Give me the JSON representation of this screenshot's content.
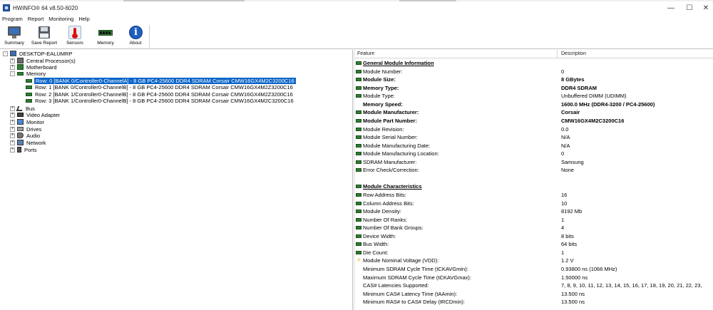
{
  "window": {
    "title": "HWiNFO® 64 v8.50-6020",
    "minimize_glyph": "—",
    "maximize_glyph": "☐",
    "close_glyph": "✕"
  },
  "menu": [
    "Program",
    "Report",
    "Monitoring",
    "Help"
  ],
  "toolbar": [
    {
      "label": "Summary",
      "icon": "monitor-icon"
    },
    {
      "label": "Save Report",
      "icon": "floppy-disk-icon"
    },
    {
      "label": "Sensors",
      "icon": "thermometer-icon"
    },
    {
      "label": "Memory",
      "icon": "ram-stick-icon"
    },
    {
      "label": "About",
      "icon": "info-icon"
    }
  ],
  "tree": {
    "root": "DESKTOP-EALUMRP",
    "nodes": [
      {
        "label": "Central Processor(s)",
        "expander": "+"
      },
      {
        "label": "Motherboard",
        "expander": "+"
      },
      {
        "label": "Memory",
        "expander": "-"
      }
    ],
    "memory_rows": [
      "Row: 0 [BANK 0/Controller0-ChannelA] - 8 GB PC4-25600 DDR4 SDRAM Corsair CMW16GX4M2C3200C16",
      "Row: 1 [BANK 0/Controller0-ChannelB] - 8 GB PC4-25600 DDR4 SDRAM Corsair CMW16GX4M2Z3200C16",
      "Row: 2 [BANK 1/Controller0-ChannelB] - 8 GB PC4-25600 DDR4 SDRAM Corsair CMW16GX4M2Z3200C16",
      "Row: 3 [BANK 1/Controller0-ChannelB] - 8 GB PC4-25600 DDR4 SDRAM Corsair CMW16GX4M2C3200C16"
    ],
    "other_nodes": [
      {
        "label": "Bus",
        "expander": "+"
      },
      {
        "label": "Video Adapter",
        "expander": "+"
      },
      {
        "label": "Monitor",
        "expander": "+"
      },
      {
        "label": "Drives",
        "expander": "+"
      },
      {
        "label": "Audio",
        "expander": "+"
      },
      {
        "label": "Network",
        "expander": "+"
      },
      {
        "label": "Ports",
        "expander": "+"
      }
    ]
  },
  "details": {
    "header_feature": "Feature",
    "header_description": "Description",
    "rows": [
      {
        "type": "section",
        "feature": "General Module Information",
        "value": ""
      },
      {
        "type": "item",
        "feature": "Module Number:",
        "value": "0"
      },
      {
        "type": "bold",
        "feature": "Module Size:",
        "value": "8 GBytes"
      },
      {
        "type": "bold",
        "feature": "Memory Type:",
        "value": "DDR4 SDRAM"
      },
      {
        "type": "item",
        "feature": "Module Type:",
        "value": "Unbuffered DIMM (UDIMM)"
      },
      {
        "type": "bold-noicon",
        "feature": "Memory Speed:",
        "value": "1600.0 MHz (DDR4-3200 / PC4-25600)"
      },
      {
        "type": "bold",
        "feature": "Module Manufacturer:",
        "value": "Corsair"
      },
      {
        "type": "bold",
        "feature": "Module Part Number:",
        "value": "CMW16GX4M2C3200C16"
      },
      {
        "type": "item",
        "feature": "Module Revision:",
        "value": "0.0"
      },
      {
        "type": "item",
        "feature": "Module Serial Number:",
        "value": "N/A"
      },
      {
        "type": "item",
        "feature": "Module Manufacturing Date:",
        "value": "N/A"
      },
      {
        "type": "item",
        "feature": "Module Manufacturing Location:",
        "value": "0"
      },
      {
        "type": "item",
        "feature": "SDRAM Manufacturer:",
        "value": "Samsung"
      },
      {
        "type": "item",
        "feature": "Error Check/Correction:",
        "value": "None"
      },
      {
        "type": "blank",
        "feature": "",
        "value": ""
      },
      {
        "type": "section",
        "feature": "Module Characteristics",
        "value": ""
      },
      {
        "type": "item",
        "feature": "Row Address Bits:",
        "value": "16"
      },
      {
        "type": "item",
        "feature": "Column Address Bits:",
        "value": "10"
      },
      {
        "type": "item",
        "feature": "Module Density:",
        "value": "8192 Mb"
      },
      {
        "type": "item",
        "feature": "Number Of Ranks:",
        "value": "1"
      },
      {
        "type": "item",
        "feature": "Number Of Bank Groups:",
        "value": "4"
      },
      {
        "type": "item",
        "feature": "Device Width:",
        "value": "8 bits"
      },
      {
        "type": "item",
        "feature": "Bus Width:",
        "value": "64 bits"
      },
      {
        "type": "item",
        "feature": "Die Count:",
        "value": "1"
      },
      {
        "type": "bolt",
        "feature": "Module Nominal Voltage (VDD):",
        "value": "1.2 V"
      },
      {
        "type": "noicon",
        "feature": "Minimum SDRAM Cycle Time (tCKAVGmin):",
        "value": "0.93800 ns (1066 MHz)"
      },
      {
        "type": "noicon",
        "feature": "Maximum SDRAM Cycle Time (tCKAVGmax):",
        "value": "1.50000 ns"
      },
      {
        "type": "noicon",
        "feature": "CAS# Latencies Supported:",
        "value": "7, 8, 9, 10, 11, 12, 13, 14, 15, 16, 17, 18, 19, 20, 21, 22, 23,"
      },
      {
        "type": "noicon",
        "feature": "Minimum CAS# Latency Time (tAAmin):",
        "value": "13.500 ns"
      },
      {
        "type": "noicon",
        "feature": "Minimum RAS# to CAS# Delay (tRCDmin):",
        "value": "13.500 ns"
      }
    ]
  }
}
